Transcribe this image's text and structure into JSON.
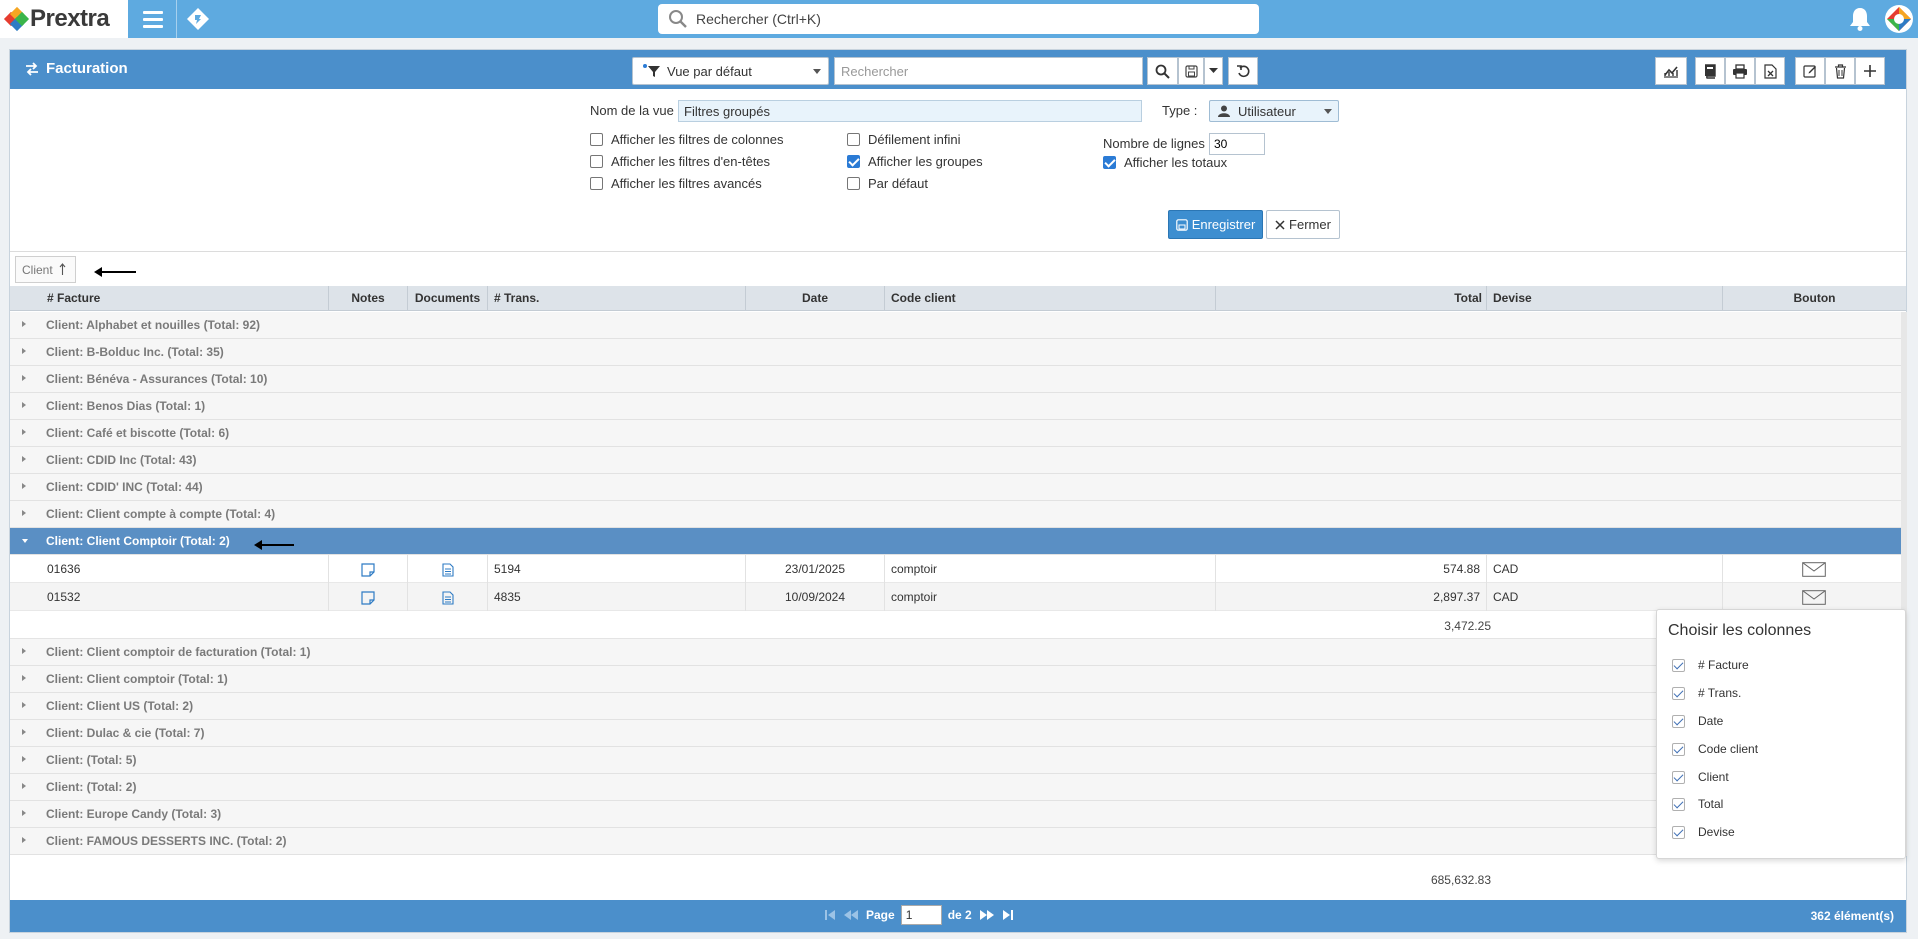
{
  "topbar": {
    "logo_text": "Prextra",
    "search_placeholder": "Rechercher (Ctrl+K)"
  },
  "panel": {
    "title": "Facturation",
    "view_select": "Vue par défaut",
    "search_placeholder": "Rechercher"
  },
  "options": {
    "view_name_label": "Nom de la vue :",
    "view_name_value": "Filtres groupés",
    "type_label": "Type :",
    "type_value": "Utilisateur",
    "checkboxes": [
      {
        "label": "Afficher les filtres de colonnes",
        "checked": false
      },
      {
        "label": "Afficher les filtres d'en-têtes",
        "checked": false
      },
      {
        "label": "Afficher les filtres avancés",
        "checked": false
      },
      {
        "label": "Défilement infini",
        "checked": false
      },
      {
        "label": "Afficher les groupes",
        "checked": true
      },
      {
        "label": "Par défaut",
        "checked": false
      },
      {
        "label": "Afficher les totaux",
        "checked": true
      }
    ],
    "lines_label": "Nombre de lignes :",
    "lines_value": "30",
    "save_label": "Enregistrer",
    "close_label": "Fermer"
  },
  "group_chip": "Client",
  "grid": {
    "columns": [
      "# Facture",
      "Notes",
      "Documents",
      "# Trans.",
      "Date",
      "Code client",
      "Total",
      "Devise",
      "Bouton"
    ],
    "groups_before": [
      "Client: Alphabet et nouilles (Total: 92)",
      "Client: B-Bolduc Inc. (Total: 35)",
      "Client: Bénéva - Assurances (Total: 10)",
      "Client: Benos Dias (Total: 1)",
      "Client: Café et biscotte (Total: 6)",
      "Client: CDID Inc (Total: 43)",
      "Client: CDID' INC (Total: 44)",
      "Client: Client compte à compte (Total: 4)"
    ],
    "active_group": "Client: Client Comptoir (Total: 2)",
    "rows": [
      {
        "facture": "01636",
        "trans": "5194",
        "date": "23/01/2025",
        "code": "comptoir",
        "total": "574.88",
        "devise": "CAD"
      },
      {
        "facture": "01532",
        "trans": "4835",
        "date": "10/09/2024",
        "code": "comptoir",
        "total": "2,897.37",
        "devise": "CAD"
      }
    ],
    "subtotal": "3,472.25",
    "groups_after": [
      "Client: Client comptoir de facturation (Total: 1)",
      "Client: Client comptoir  (Total: 1)",
      "Client: Client US  (Total: 2)",
      "Client: Dulac & cie (Total: 7)",
      "Client:  (Total: 5)",
      "Client:  (Total: 2)",
      "Client: Europe Candy (Total: 3)",
      "Client: FAMOUS DESSERTS INC. (Total: 2)"
    ],
    "grand_total": "685,632.83"
  },
  "chooser": {
    "title": "Choisir les colonnes",
    "items": [
      "# Facture",
      "# Trans.",
      "Date",
      "Code client",
      "Client",
      "Total",
      "Devise"
    ]
  },
  "footer": {
    "page_label": "Page",
    "page_value": "1",
    "of_label": "de 2",
    "items_count": "362 élément(s)"
  },
  "colors": {
    "topbar": "#5eaae0",
    "panel_header": "#4b8fcb",
    "active_group": "#5a8fc4",
    "save_button": "#3d8ed0"
  }
}
